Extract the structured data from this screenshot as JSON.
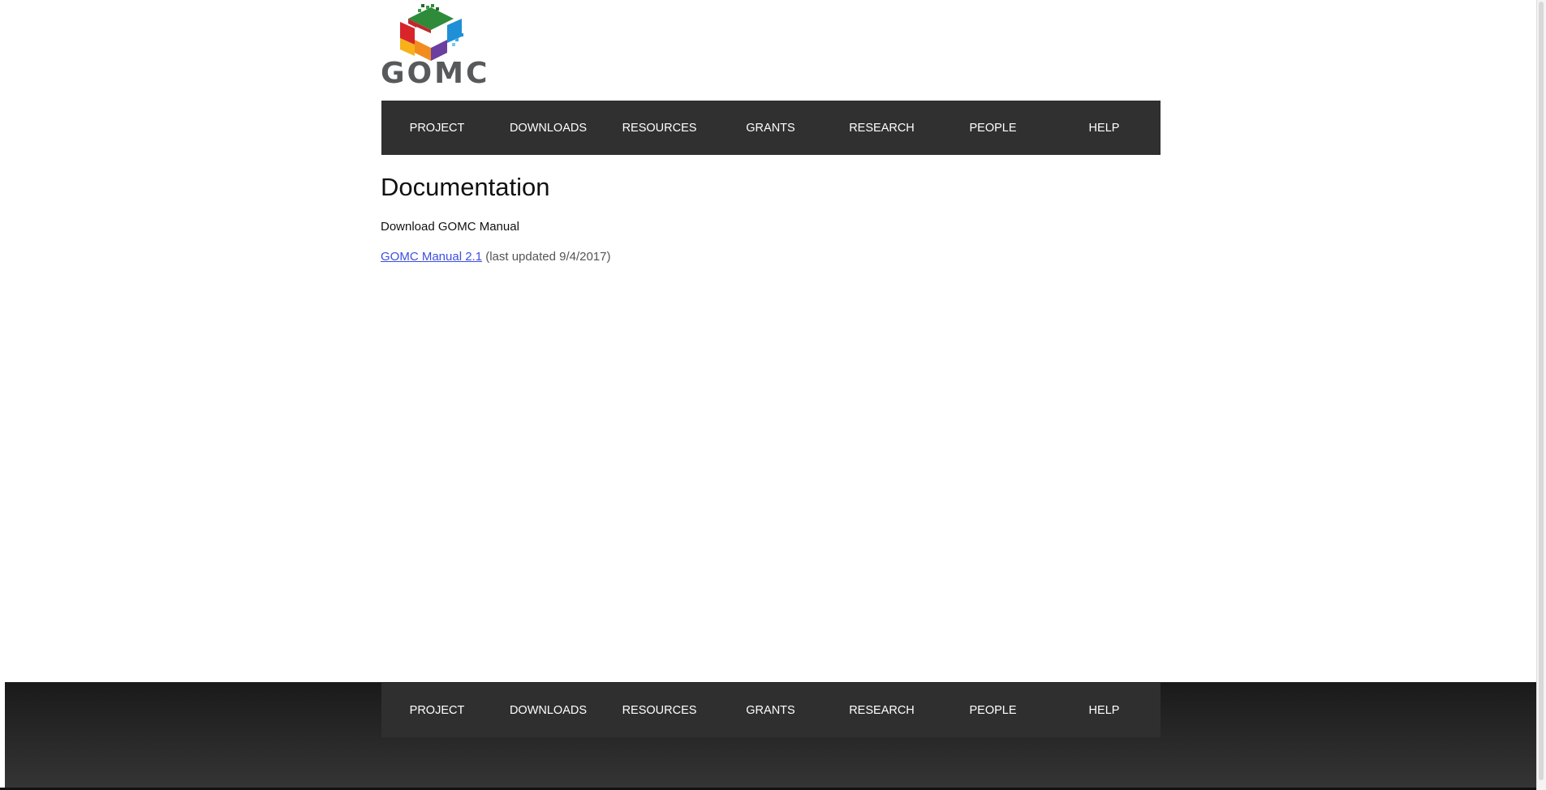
{
  "logo": {
    "text": "GOMC"
  },
  "nav": {
    "items": [
      "PROJECT",
      "DOWNLOADS",
      "RESOURCES",
      "GRANTS",
      "RESEARCH",
      "PEOPLE",
      "HELP"
    ]
  },
  "main": {
    "title": "Documentation",
    "subheading": "Download GOMC Manual",
    "manual_link": "GOMC Manual 2.1",
    "manual_note": " (last updated 9/4/2017)"
  },
  "colors": {
    "nav_background": "#303030",
    "link": "#3d4fe0"
  }
}
